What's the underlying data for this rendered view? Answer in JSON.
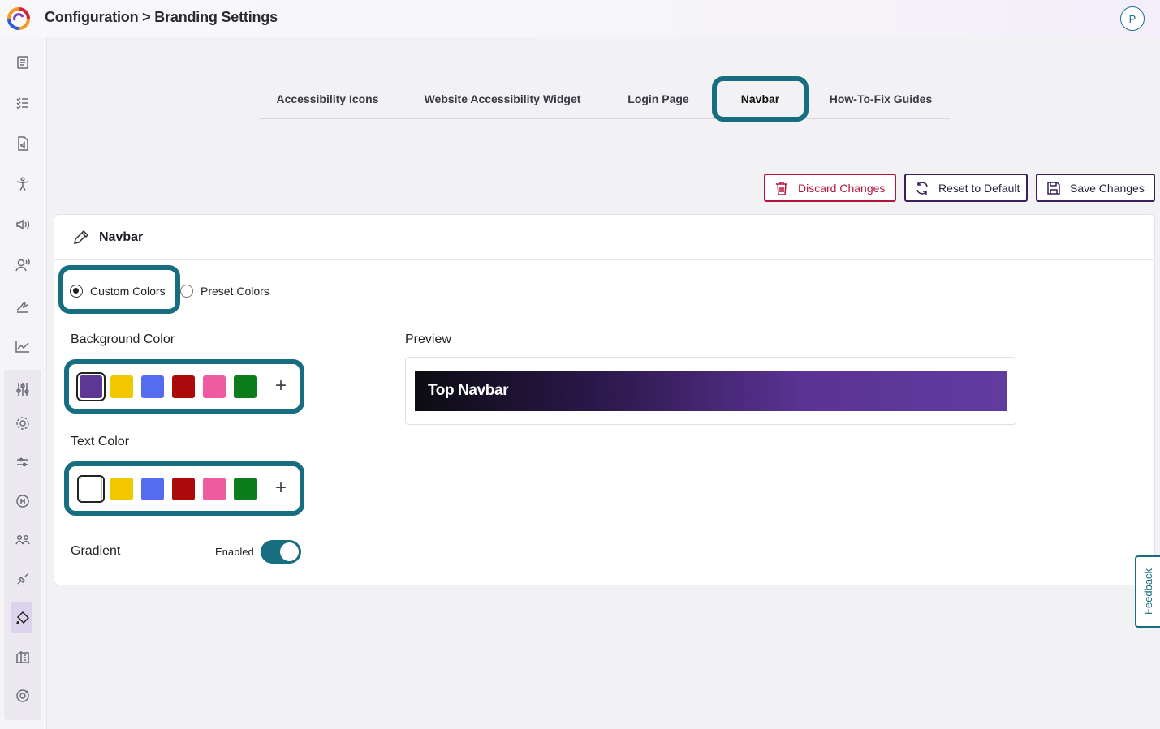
{
  "header": {
    "breadcrumb": "Configuration > Branding Settings",
    "avatar_initial": "P"
  },
  "tabs": [
    {
      "label": "Accessibility Icons"
    },
    {
      "label": "Website Accessibility Widget"
    },
    {
      "label": "Login Page"
    },
    {
      "label": "Navbar",
      "active": true
    },
    {
      "label": "How-To-Fix Guides"
    }
  ],
  "actions": {
    "discard": "Discard Changes",
    "reset": "Reset to Default",
    "save": "Save Changes"
  },
  "card": {
    "title": "Navbar",
    "mode_options": [
      {
        "label": "Custom Colors",
        "selected": true
      },
      {
        "label": "Preset Colors",
        "selected": false
      }
    ],
    "background_color": {
      "label": "Background Color",
      "swatches": [
        "#5d3795",
        "#f2c700",
        "#566cf0",
        "#ab0a0a",
        "#f05a9e",
        "#0b7d1d"
      ],
      "selected_index": 0
    },
    "text_color": {
      "label": "Text Color",
      "swatches": [
        "#ffffff",
        "#f2c700",
        "#566cf0",
        "#ab0a0a",
        "#f05a9e",
        "#0b7d1d"
      ],
      "selected_index": 0
    },
    "preview": {
      "label": "Preview",
      "navbar_text": "Top Navbar"
    },
    "gradient": {
      "label": "Gradient",
      "state_text": "Enabled",
      "enabled": true
    }
  },
  "feedback_label": "Feedback",
  "colors": {
    "accent_teal": "#176e80",
    "discard_red": "#b0163c",
    "brand_purple": "#3a1f5c"
  }
}
